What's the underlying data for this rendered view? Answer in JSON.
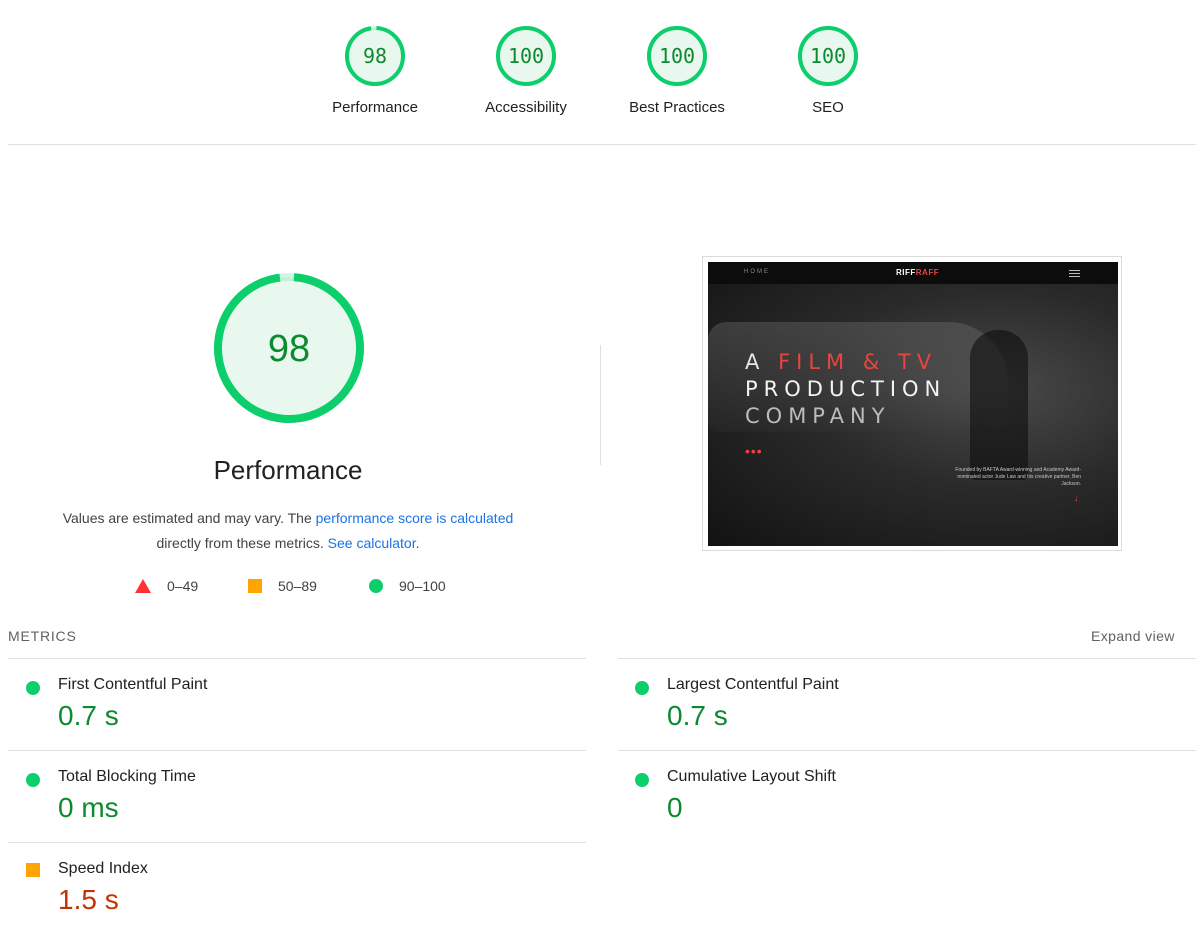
{
  "summary": {
    "gauges": [
      {
        "score": "98",
        "label": "Performance",
        "fraction": 0.98
      },
      {
        "score": "100",
        "label": "Accessibility",
        "fraction": 1.0
      },
      {
        "score": "100",
        "label": "Best Practices",
        "fraction": 1.0
      },
      {
        "score": "100",
        "label": "SEO",
        "fraction": 1.0
      }
    ]
  },
  "performance": {
    "score": "98",
    "fraction": 0.98,
    "title": "Performance",
    "desc_prefix": "Values are estimated and may vary. The ",
    "score_link": "performance score is calculated",
    "desc_middle": "directly from these metrics.",
    "calc_link": "See calculator",
    "desc_suffix": "."
  },
  "legend": [
    {
      "range": "0–49",
      "icon": "triangle-icon",
      "color": "#ff3333"
    },
    {
      "range": "50–89",
      "icon": "square-icon",
      "color": "#ffa400"
    },
    {
      "range": "90–100",
      "icon": "circle-icon",
      "color": "#0cce6b"
    }
  ],
  "screenshot": {
    "nav": "HOME",
    "logo_prefix": "RIFF",
    "logo_suffix": "RAFF",
    "line1_a": "A",
    "line1_b": "FILM & TV",
    "line2": "PRODUCTION",
    "line3": "COMPANY",
    "dots": "•••",
    "caption": "Founded by BAFTA Award-winning and Academy Award-nominated actor Jude Law and his creative partner, Ben Jackson.",
    "arrow": "↓"
  },
  "metrics": {
    "heading": "METRICS",
    "expand": "Expand view",
    "items": [
      {
        "name": "First Contentful Paint",
        "value": "0.7 s",
        "status": "good"
      },
      {
        "name": "Largest Contentful Paint",
        "value": "0.7 s",
        "status": "good"
      },
      {
        "name": "Total Blocking Time",
        "value": "0 ms",
        "status": "good"
      },
      {
        "name": "Cumulative Layout Shift",
        "value": "0",
        "status": "good"
      },
      {
        "name": "Speed Index",
        "value": "1.5 s",
        "status": "average"
      }
    ]
  },
  "colors": {
    "pass": "#0cce6b",
    "pass_text": "#0c8a2f",
    "pass_fill": "#e9f8ee",
    "average": "#ffa400",
    "average_text": "#c33300",
    "fail": "#ff3333",
    "link": "#1a73e8"
  }
}
